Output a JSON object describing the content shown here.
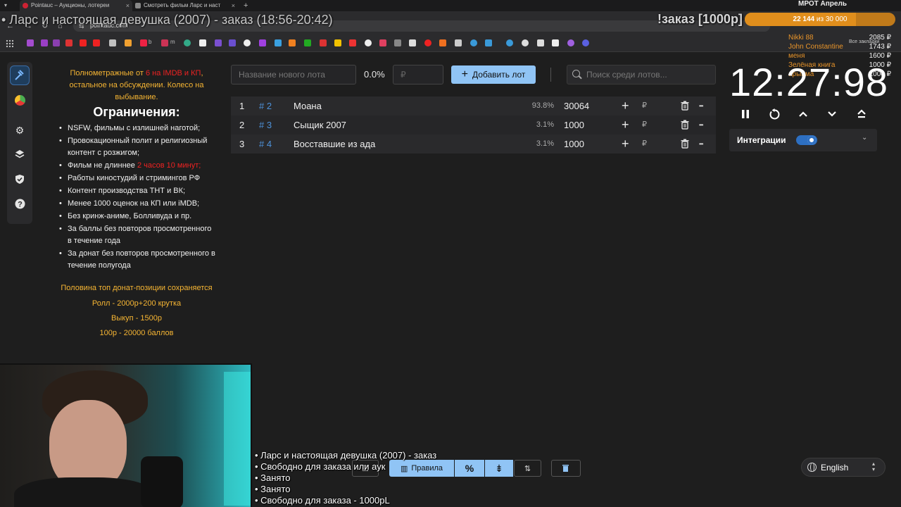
{
  "browser": {
    "tabs": [
      {
        "title": "Pointauc – Аукционы, лотереи",
        "active": true
      },
      {
        "title": "Смотреть фильм Ларс и наст",
        "active": false
      }
    ],
    "url": "pointauc.com",
    "bookmarks": [
      "b",
      "m"
    ],
    "all_bookmarks": "Все закладки"
  },
  "stream": {
    "title": "• Ларс и настоящая девушка (2007) - заказ (18:56-20:42)",
    "order_badge": "!заказ [1000р]",
    "mrot": {
      "title": "МРОТ Апрель",
      "progress": 0.7381,
      "current": "22 144",
      "of_label": "из 30 000"
    },
    "donors": [
      {
        "name": "Nikki 88",
        "amount": "2085 ₽"
      },
      {
        "name": "John Constantine",
        "amount": "1743 ₽"
      },
      {
        "name": "меня",
        "amount": "1600 ₽"
      },
      {
        "name": "Зелёная книга",
        "amount": "1000 ₽"
      },
      {
        "name": "арыйма",
        "amount": "1000 ₽"
      }
    ],
    "overlay_lines": [
      "• Ларс и настоящая девушка (2007) - заказ",
      "• Свободно для заказа или аук",
      "• Занято",
      "• Занято",
      "• Свободно для заказа - 1000рL"
    ]
  },
  "rules": {
    "intro_part1": "Полнометражные от ",
    "intro_highlight": "6 на IMDB и КП",
    "intro_part2": ", остальное на обсуждении. Колесо на выбывание.",
    "heading": "Ограничения:",
    "items": [
      {
        "text": "NSFW, фильмы с излишней наготой;"
      },
      {
        "text": "Провокационный полит и религиозный контент с розжигом;"
      },
      {
        "text": "Фильм не длиннее ",
        "highlight": "2 часов 10 минут;"
      },
      {
        "text": "Работы киностудий и стримингов РФ"
      },
      {
        "text": "Контент производства ТНТ и ВК;"
      },
      {
        "text": "Менее 1000 оценок на КП или iMDB;"
      },
      {
        "text": "Без кринж-аниме, Болливуда и пр."
      },
      {
        "text": "За баллы без повторов просмотренного в течение года"
      },
      {
        "text": "За донат без повторов просмотренного в течение полугода"
      }
    ],
    "footer": [
      "Половина топ донат-позиции сохраняется",
      "Ролл - 2000р+200 крутка",
      "Выкуп - 1500р",
      "100р - 20000 баллов"
    ]
  },
  "controls": {
    "lot_name_placeholder": "Название нового лота",
    "percent": "0.0%",
    "amount_placeholder": "₽",
    "add_button": "Добавить лот",
    "search_placeholder": "Поиск среди лотов..."
  },
  "lots": [
    {
      "pos": "1",
      "id": "# 2",
      "name": "Моана",
      "pct": "93.8%",
      "amount": "30064",
      "currency": "₽"
    },
    {
      "pos": "2",
      "id": "# 3",
      "name": "Сыщик 2007",
      "pct": "3.1%",
      "amount": "1000",
      "currency": "₽"
    },
    {
      "pos": "3",
      "id": "# 4",
      "name": "Восставшие из ада",
      "pct": "3.1%",
      "amount": "1000",
      "currency": "₽"
    }
  ],
  "timer": {
    "value": "12:27:98"
  },
  "integrations": {
    "label": "Интеграции",
    "enabled": true
  },
  "toolbar": {
    "rules_label": "Правила"
  },
  "language": "English",
  "colors": {
    "accent": "#90c4f5",
    "lot_id": "#4e92da",
    "rules_gold": "#f6b533",
    "rules_red": "#e22222",
    "mrot_bar": "#e08e1c",
    "toggle": "#2d6fc2"
  },
  "icons": {
    "sidebar": [
      "hammer-icon",
      "pie-chart-icon",
      "gear-icon",
      "layers-icon",
      "shield-icon",
      "help-icon"
    ],
    "timer_controls": [
      "pause-icon",
      "restart-icon",
      "chevron-up-icon",
      "chevron-down-icon",
      "eject-icon"
    ]
  }
}
